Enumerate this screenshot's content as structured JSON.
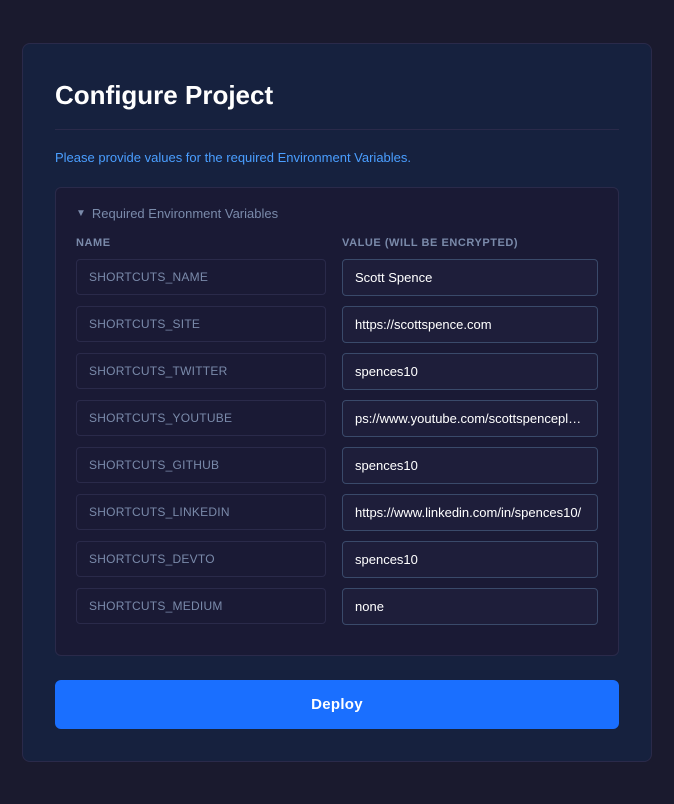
{
  "modal": {
    "title": "Configure Project",
    "subtitle": "Please provide values for the required Environment Variables.",
    "section_label": "Required Environment Variables",
    "columns": {
      "name_header": "NAME",
      "value_header": "VALUE (WILL BE ENCRYPTED)"
    },
    "env_vars": [
      {
        "name": "SHORTCUTS_NAME",
        "value": "Scott Spence"
      },
      {
        "name": "SHORTCUTS_SITE",
        "value": "https://scottspence.com"
      },
      {
        "name": "SHORTCUTS_TWITTER",
        "value": "spences10"
      },
      {
        "name": "SHORTCUTS_YOUTUBE",
        "value": "ps://www.youtube.com/scottspenceplease"
      },
      {
        "name": "SHORTCUTS_GITHUB",
        "value": "spences10"
      },
      {
        "name": "SHORTCUTS_LINKEDIN",
        "value": "https://www.linkedin.com/in/spences10/"
      },
      {
        "name": "SHORTCUTS_DEVTO",
        "value": "spences10"
      },
      {
        "name": "SHORTCUTS_MEDIUM",
        "value": "none"
      }
    ],
    "deploy_button_label": "Deploy"
  }
}
